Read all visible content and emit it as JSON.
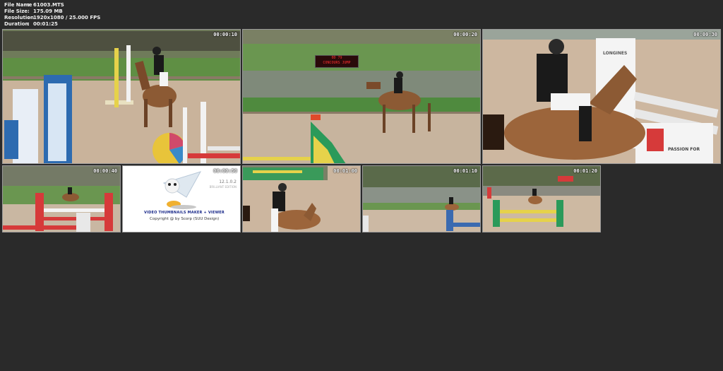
{
  "info": {
    "rows": [
      {
        "label": "File Name",
        "sep": ":",
        "value": "61003.MTS"
      },
      {
        "label": "File Size",
        "sep": ":",
        "value": "175.09 MB"
      },
      {
        "label": "Resolution",
        "sep": ":",
        "value": "1920x1080 / 25.000 FPS"
      },
      {
        "label": "Duration",
        "sep": ":",
        "value": "00:01:25"
      }
    ]
  },
  "thumbnails": [
    {
      "timestamp": "00:00:10"
    },
    {
      "timestamp": "00:00:20"
    },
    {
      "timestamp": "00:00:30"
    },
    {
      "timestamp": "00:00:40"
    },
    {
      "timestamp": "00:00:50"
    },
    {
      "timestamp": "00:01:00"
    },
    {
      "timestamp": "00:01:10"
    },
    {
      "timestamp": "00:01:20"
    }
  ],
  "logo": {
    "title": "VIDEO THUMBNAILS MAKER + VIEWER",
    "copyright": "Copyright @ by Scorp (SUU Design)",
    "version": "12.1.0.2",
    "edition": "BRILLIANT EDITION"
  },
  "scoreboard": {
    "line1": "0D 79",
    "line2": "CONCOURS JUMP"
  },
  "signs": {
    "sign1": "LONGINES",
    "sign2": "PASSION FOR"
  },
  "colors": {
    "background": "#2a2a2a",
    "sand": "#c9b39b",
    "grass": "#6f9a4e"
  }
}
